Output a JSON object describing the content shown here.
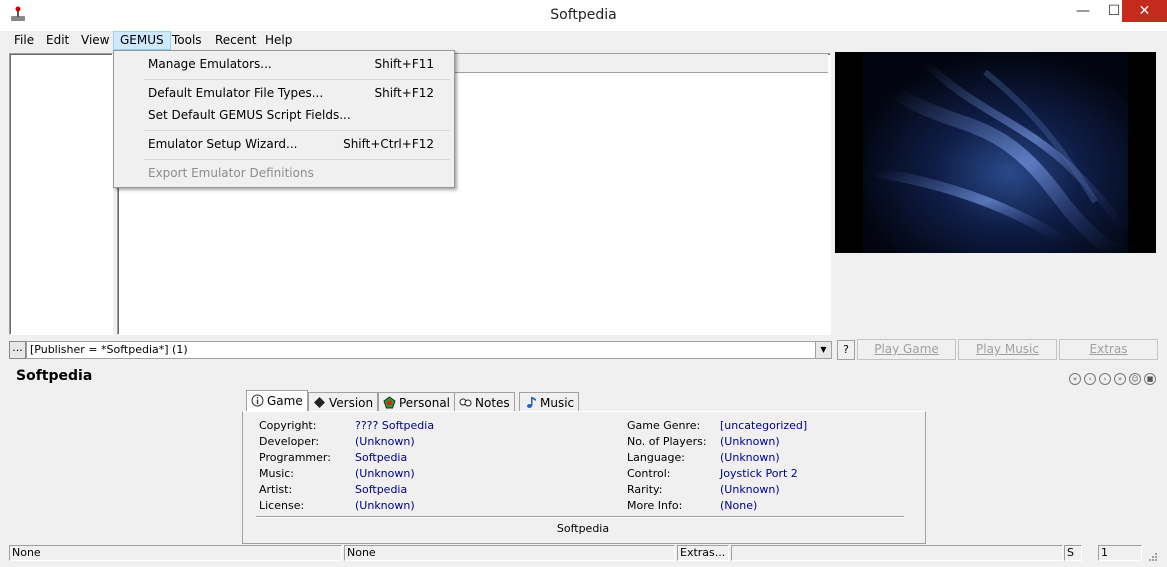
{
  "window": {
    "title": "Softpedia",
    "min_glyph": "—",
    "max_glyph": "☐",
    "close_glyph": "✕",
    "app_icon": "joystick-icon"
  },
  "menubar": {
    "items": [
      {
        "label": "File"
      },
      {
        "label": "Edit"
      },
      {
        "label": "View"
      },
      {
        "label": "GEMUS"
      },
      {
        "label": "Tools"
      },
      {
        "label": "Recent"
      },
      {
        "label": "Help"
      }
    ]
  },
  "gemus_menu": {
    "items": [
      {
        "label": "Manage Emulators...",
        "shortcut": "Shift+F11"
      },
      {
        "label": "Default Emulator File Types...",
        "shortcut": "Shift+F12"
      },
      {
        "label": "Set Default GEMUS Script Fields...",
        "shortcut": ""
      },
      {
        "label": "Emulator Setup Wizard...",
        "shortcut": "Shift+Ctrl+F12"
      },
      {
        "label": "Export Emulator Definitions",
        "shortcut": "",
        "disabled": true
      }
    ]
  },
  "filter": {
    "button_label": "...",
    "value": "[Publisher = *Softpedia*]  (1)",
    "help_label": "?"
  },
  "buttons": {
    "play_game": "Play Game",
    "play_music": "Play Music",
    "extras": "Extras"
  },
  "detail": {
    "title": "Softpedia",
    "tabs": [
      {
        "label": "Game",
        "icon": "info-icon"
      },
      {
        "label": "Version",
        "icon": "diamond-icon"
      },
      {
        "label": "Personal",
        "icon": "personal-icon"
      },
      {
        "label": "Notes",
        "icon": "notes-icon"
      },
      {
        "label": "Music",
        "icon": "music-note-icon"
      }
    ],
    "left_fields": [
      {
        "label": "Copyright:",
        "value": "???? Softpedia"
      },
      {
        "label": "Developer:",
        "value": "(Unknown)"
      },
      {
        "label": "Programmer:",
        "value": "Softpedia"
      },
      {
        "label": "Music:",
        "value": "(Unknown)"
      },
      {
        "label": "Artist:",
        "value": "Softpedia"
      },
      {
        "label": "License:",
        "value": "(Unknown)"
      }
    ],
    "right_fields": [
      {
        "label": "Game Genre:",
        "value": "[uncategorized]"
      },
      {
        "label": "No. of Players:",
        "value": "(Unknown)"
      },
      {
        "label": "Language:",
        "value": "(Unknown)"
      },
      {
        "label": "Control:",
        "value": "Joystick Port 2"
      },
      {
        "label": "Rarity:",
        "value": "(Unknown)"
      },
      {
        "label": "More Info:",
        "value": "(None)"
      }
    ],
    "footer": "Softpedia"
  },
  "status": {
    "cell1": "None",
    "cell2": "None",
    "cell3": "Extras...",
    "cell4": "",
    "cell5": "S",
    "cell6": "1"
  },
  "colors": {
    "link_value": "#00008b",
    "close_button": "#c42b1c",
    "menu_highlight": "#cde8ff"
  }
}
